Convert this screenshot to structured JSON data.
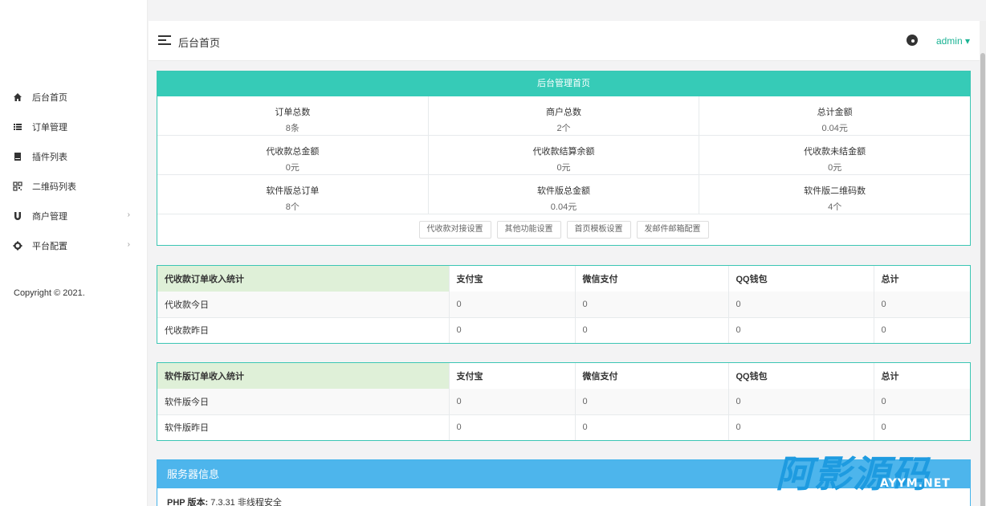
{
  "header": {
    "title": "后台首页",
    "user": "admin"
  },
  "sidebar": {
    "items": [
      {
        "label": "后台首页",
        "icon": "home-icon",
        "has_arrow": false
      },
      {
        "label": "订单管理",
        "icon": "list-icon",
        "has_arrow": false
      },
      {
        "label": "插件列表",
        "icon": "book-icon",
        "has_arrow": false
      },
      {
        "label": "二维码列表",
        "icon": "qrcode-icon",
        "has_arrow": false
      },
      {
        "label": "商户管理",
        "icon": "magnet-icon",
        "has_arrow": true
      },
      {
        "label": "平台配置",
        "icon": "gear-icon",
        "has_arrow": true
      }
    ],
    "copyright": "Copyright © 2021."
  },
  "overview": {
    "title": "后台管理首页",
    "rows": [
      [
        {
          "label": "订单总数",
          "value": "8条"
        },
        {
          "label": "商户总数",
          "value": "2个"
        },
        {
          "label": "总计金额",
          "value": "0.04元"
        }
      ],
      [
        {
          "label": "代收款总金额",
          "value": "0元"
        },
        {
          "label": "代收款结算余额",
          "value": "0元"
        },
        {
          "label": "代收款未结金额",
          "value": "0元"
        }
      ],
      [
        {
          "label": "软件版总订单",
          "value": "8个"
        },
        {
          "label": "软件版总金额",
          "value": "0.04元"
        },
        {
          "label": "软件版二维码数",
          "value": "4个"
        }
      ]
    ],
    "buttons": [
      "代收款对接设置",
      "其他功能设置",
      "首页模板设置",
      "发邮件邮箱配置"
    ]
  },
  "stats_collect": {
    "headers": [
      "代收款订单收入统计",
      "支付宝",
      "微信支付",
      "QQ钱包",
      "总计"
    ],
    "rows": [
      [
        "代收款今日",
        "0",
        "0",
        "0",
        "0"
      ],
      [
        "代收款昨日",
        "0",
        "0",
        "0",
        "0"
      ]
    ]
  },
  "stats_software": {
    "headers": [
      "软件版订单收入统计",
      "支付宝",
      "微信支付",
      "QQ钱包",
      "总计"
    ],
    "rows": [
      [
        "软件版今日",
        "0",
        "0",
        "0",
        "0"
      ],
      [
        "软件版昨日",
        "0",
        "0",
        "0",
        "0"
      ]
    ]
  },
  "server": {
    "title": "服务器信息",
    "php_label": "PHP 版本:",
    "php_value": "7.3.31 非线程安全"
  },
  "watermark": {
    "main": "阿影源码",
    "sub": "AYYM.NET"
  },
  "colors": {
    "accent": "#1ab394",
    "panel_head": "#36cbb7",
    "server_head": "#4db5ec"
  }
}
